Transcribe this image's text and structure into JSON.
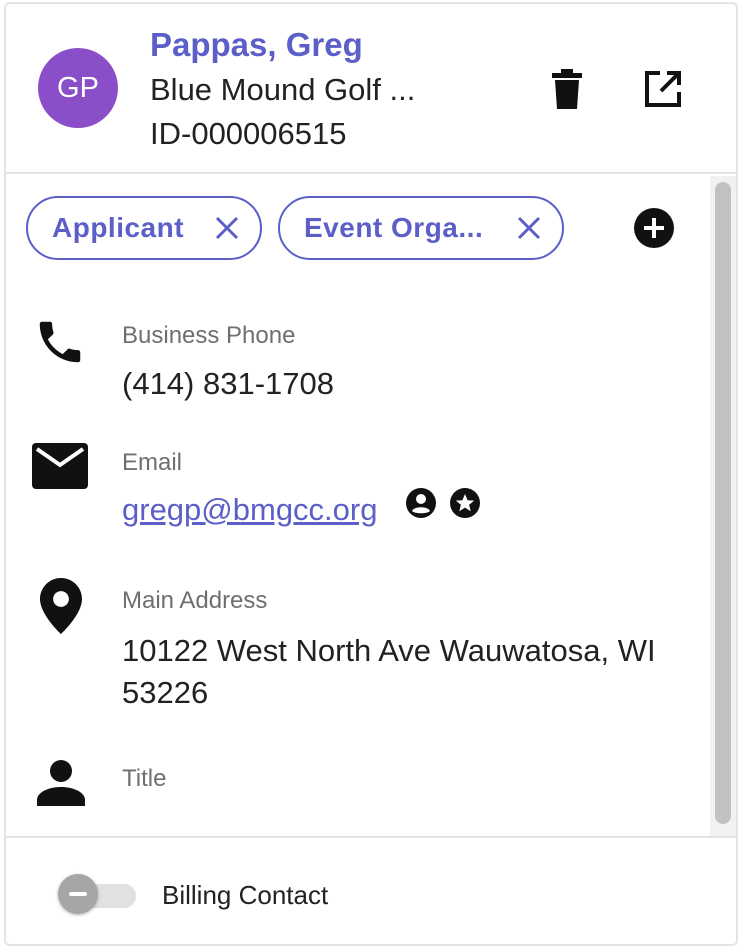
{
  "contact": {
    "initials": "GP",
    "name": "Pappas, Greg",
    "company": "Blue Mound Golf ...",
    "record_id": "ID-000006515"
  },
  "tags": [
    {
      "label": "Applicant"
    },
    {
      "label": "Event Orga..."
    }
  ],
  "fields": {
    "business_phone": {
      "label": "Business Phone",
      "value": "(414) 831-1708",
      "icon": "phone-icon"
    },
    "email": {
      "label": "Email",
      "value": "gregp@bmgcc.org",
      "icon": "mail-icon"
    },
    "main_address": {
      "label": "Main Address",
      "line1": "10122 West North Ave Wauwatosa, WI",
      "line2": "53226",
      "icon": "location-pin-icon"
    },
    "title": {
      "label": "Title",
      "value": "",
      "icon": "person-icon"
    }
  },
  "footer": {
    "billing_contact_label": "Billing Contact",
    "billing_contact_enabled": false
  },
  "colors": {
    "accent": "#5b5fc7",
    "avatar": "#8a4fc8",
    "label_gray": "#6f6f6f"
  }
}
